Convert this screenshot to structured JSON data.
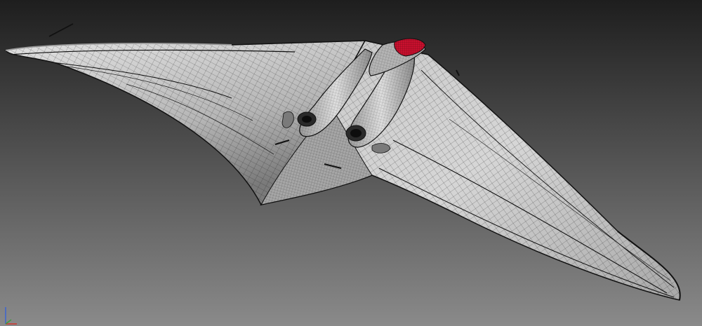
{
  "scene": {
    "background_top": "#1e1e1e",
    "background_bottom": "#8a8a8a",
    "surface_color": "#c2c2c2",
    "surface_shadow": "#8c8c8c",
    "wire_color": "#1a1a1a",
    "canopy_color": "#c8102e",
    "axis_colors": {
      "x": "#d0342c",
      "y": "#3c9b3c",
      "z": "#3c64d0"
    }
  },
  "icons": {
    "axis_gizmo": "axis-tripod-icon"
  }
}
